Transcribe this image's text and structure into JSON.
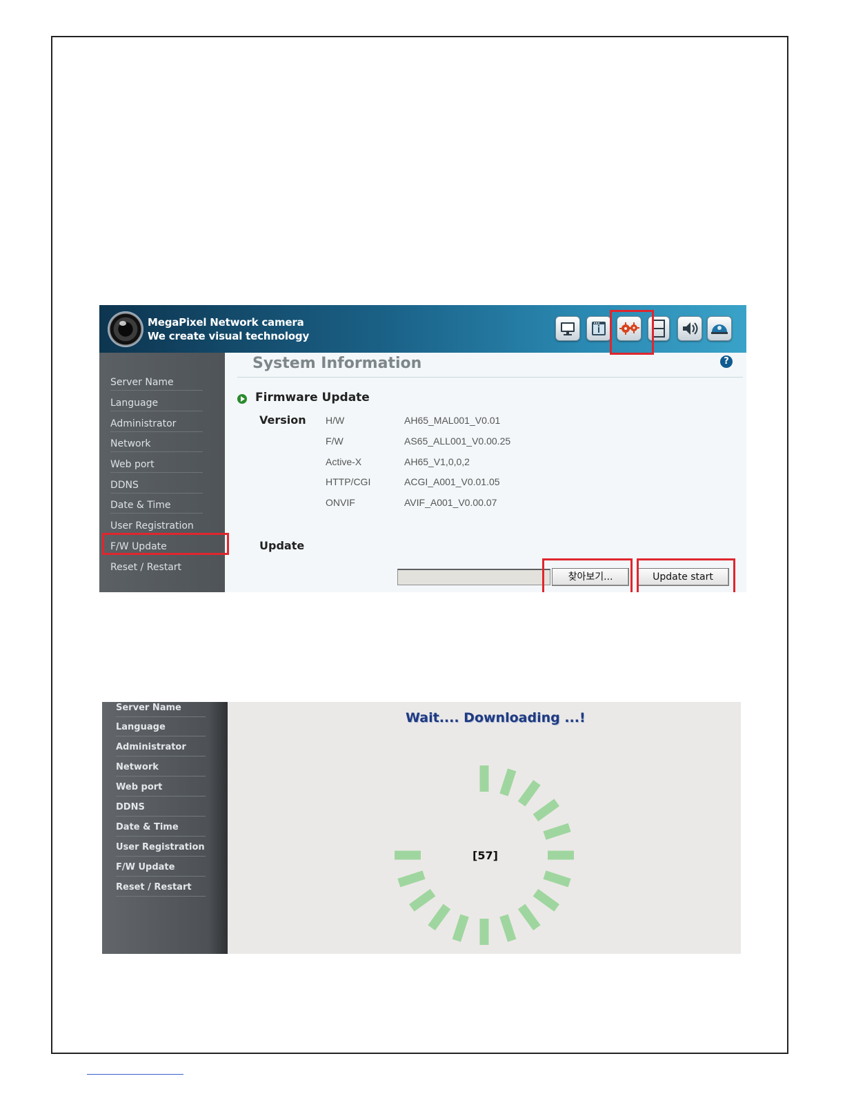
{
  "header": {
    "brand_line1": "MegaPixel Network camera",
    "brand_line2": "We create visual technology",
    "nav_icons": [
      "monitor-icon",
      "info-window-icon",
      "gears-icon",
      "film-icon",
      "speaker-icon",
      "dome-camera-icon"
    ],
    "highlight_color": "#e0262e"
  },
  "sidebar": {
    "items": [
      {
        "label": "Server Name"
      },
      {
        "label": "Language"
      },
      {
        "label": "Administrator"
      },
      {
        "label": "Network"
      },
      {
        "label": "Web port"
      },
      {
        "label": "DDNS"
      },
      {
        "label": "Date & Time"
      },
      {
        "label": "User Registration"
      },
      {
        "label": "F/W Update"
      },
      {
        "label": "Reset / Restart"
      }
    ],
    "selected": "F/W Update"
  },
  "system_info": {
    "title": "System Information",
    "help": "?",
    "section": "Firmware Update",
    "version_label": "Version",
    "versions": [
      {
        "key": "H/W",
        "value": "AH65_MAL001_V0.01"
      },
      {
        "key": "F/W",
        "value": "AS65_ALL001_V0.00.25"
      },
      {
        "key": "Active-X",
        "value": "AH65_V1,0,0,2"
      },
      {
        "key": "HTTP/CGI",
        "value": "ACGI_A001_V0.01.05"
      },
      {
        "key": "ONVIF",
        "value": "AVIF_A001_V0.00.07"
      }
    ],
    "update_label": "Update",
    "file_value": "",
    "browse_button": "찾아보기...",
    "update_button": "Update start"
  },
  "download": {
    "wait_text": "Wait.... Downloading ...!",
    "progress_counter": "[57]",
    "spinner_color": "#9fd69f"
  }
}
